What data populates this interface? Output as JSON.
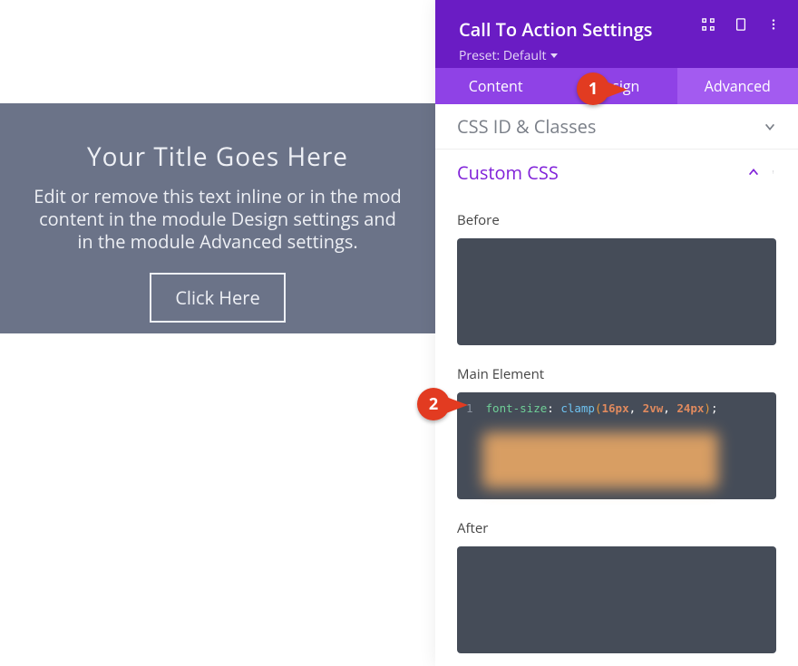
{
  "preview": {
    "title": "Your Title Goes Here",
    "desc_line1": "Edit or remove this text inline or in the mod",
    "desc_line2": "content in the module Design settings and",
    "desc_line3": "in the module Advanced settings.",
    "button": "Click Here"
  },
  "panel": {
    "title": "Call To Action Settings",
    "preset_label": "Preset: Default"
  },
  "tabs": {
    "content": "Content",
    "design": "Design",
    "advanced": "Advanced",
    "active": "advanced"
  },
  "sections": {
    "css_id_classes": "CSS ID & Classes",
    "custom_css": "Custom CSS"
  },
  "fields": {
    "before": "Before",
    "main_element": "Main Element",
    "after": "After"
  },
  "code": {
    "lineno": "1",
    "prop": "font-size",
    "colon": ":",
    "func": "clamp",
    "open_paren": "(",
    "arg1": "16px",
    "comma1": ", ",
    "arg2": "2vw",
    "comma2": ", ",
    "arg3": "24px",
    "close_paren": ")",
    "semi": ";"
  },
  "badges": {
    "b1": "1",
    "b2": "2"
  },
  "icons": {
    "fullscreen": "fullscreen-icon",
    "tablet": "tablet-icon",
    "more": "more-vertical-icon",
    "chev_down": "chevron-down-icon",
    "chev_up": "chevron-up-icon"
  }
}
